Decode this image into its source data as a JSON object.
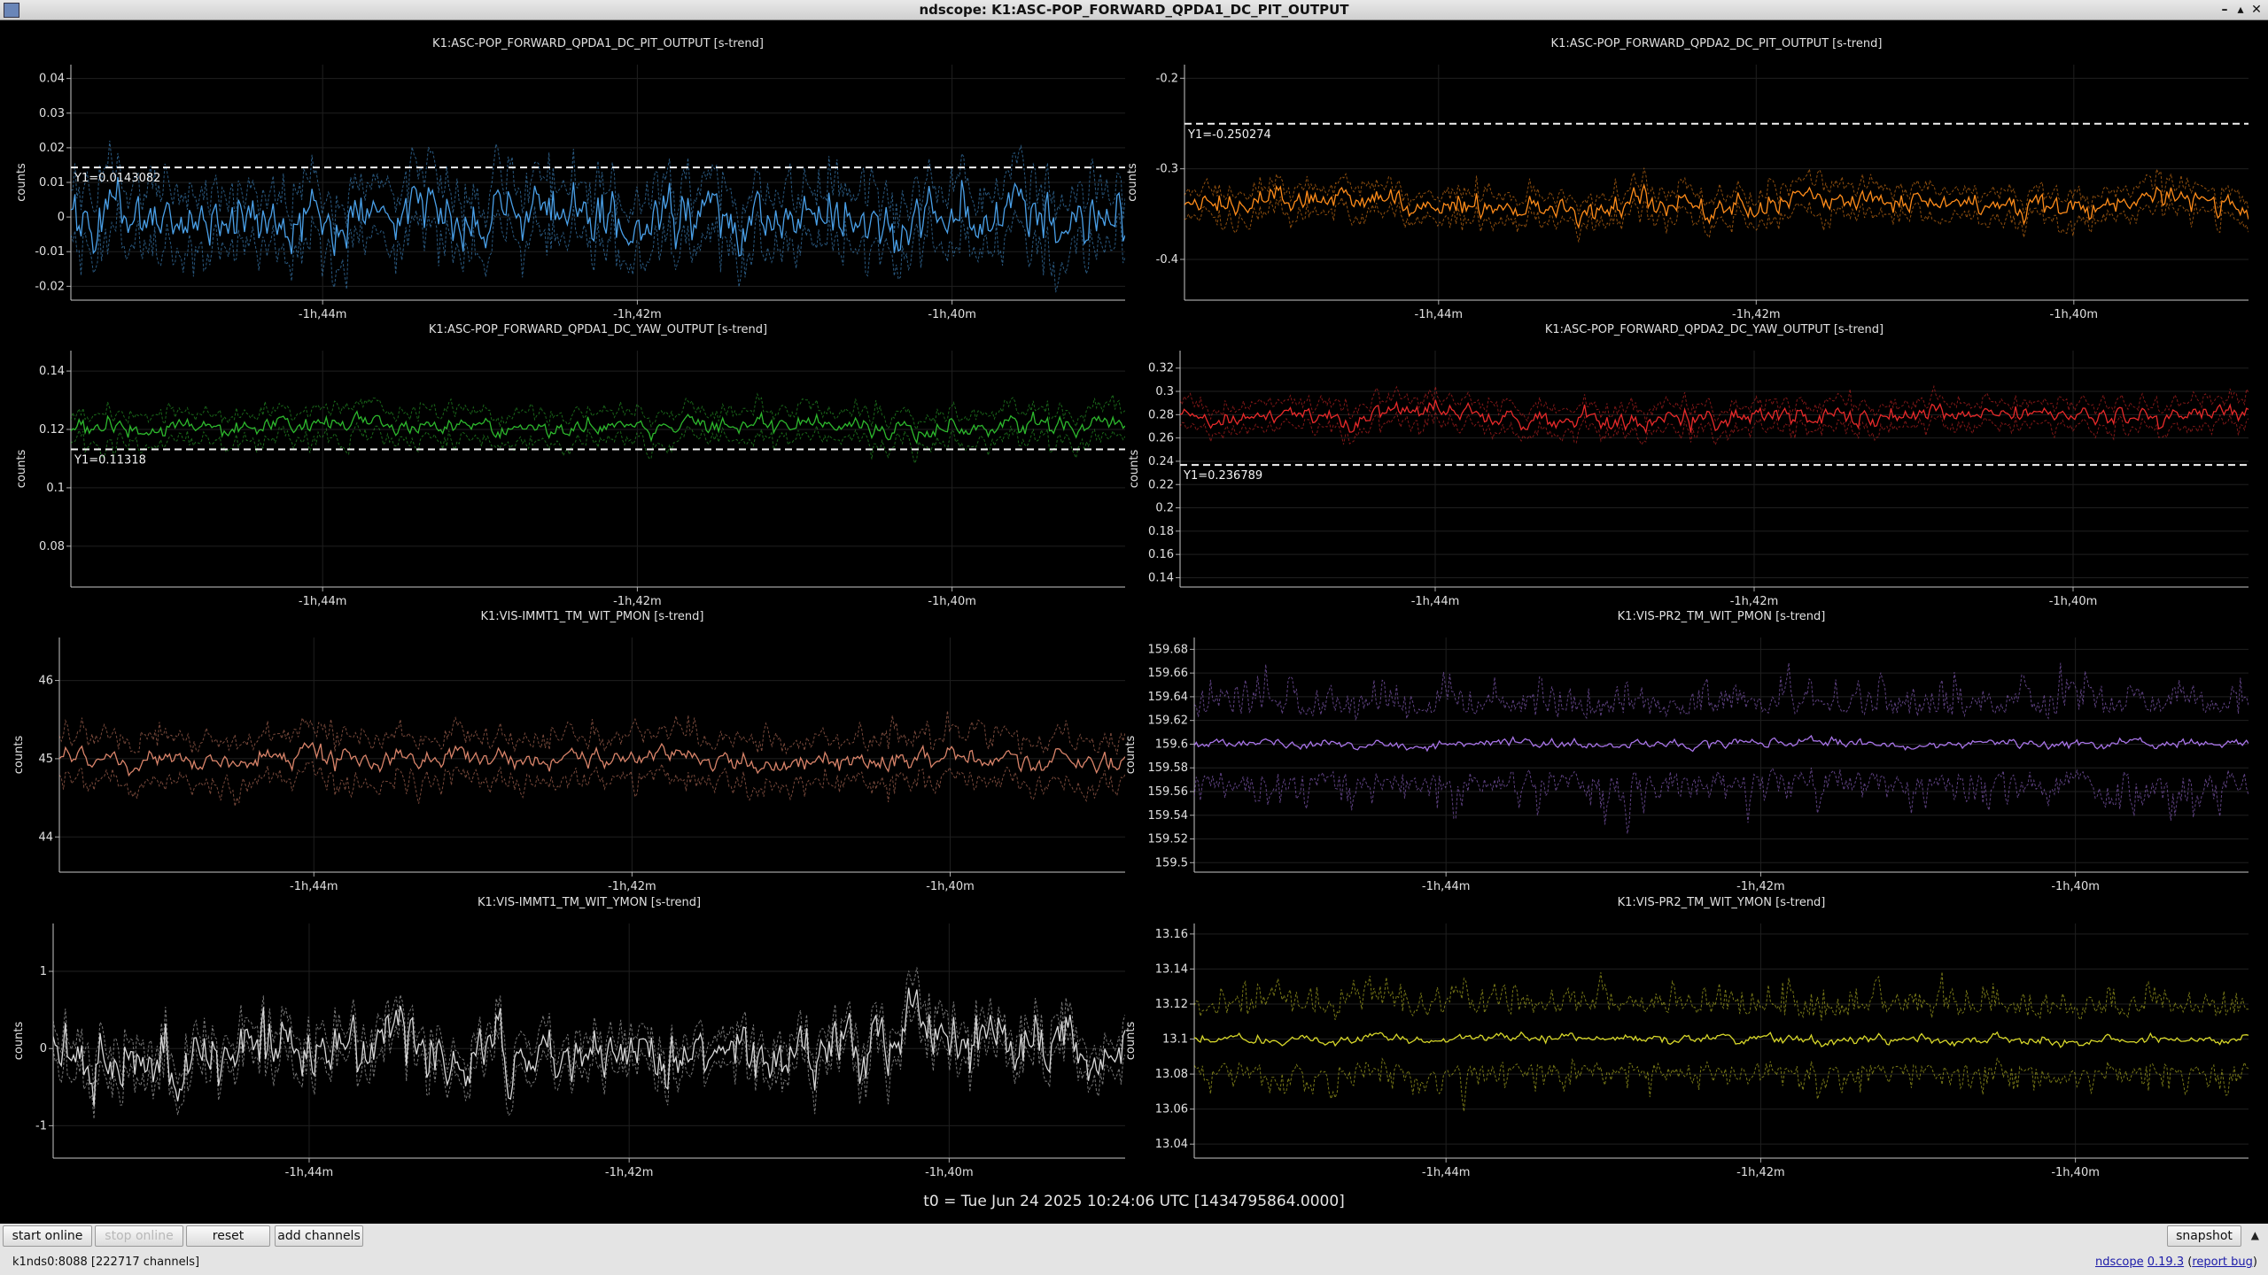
{
  "window": {
    "title": "ndscope: K1:ASC-POP_FORWARD_QPDA1_DC_PIT_OUTPUT",
    "controls": [
      "–",
      "▴",
      "✕"
    ]
  },
  "t0_label": "t0 = Tue Jun 24 2025 10:24:06 UTC [1434795864.0000]",
  "buttons": {
    "start_online": "start online",
    "stop_online": "stop online",
    "reset": "reset",
    "add_channels": "add channels",
    "snapshot": "snapshot"
  },
  "status": "k1nds0:8088  [222717 channels]",
  "footer": {
    "app": "ndscope",
    "version": "0.19.3",
    "report": "report bug"
  },
  "chart_data": [
    {
      "type": "line",
      "title": "K1:ASC-POP_FORWARD_QPDA1_DC_PIT_OUTPUT [s-trend]",
      "ylabel": "counts",
      "ylim": [
        -0.024,
        0.044
      ],
      "yticks": [
        -0.02,
        -0.01,
        0,
        0.01,
        0.02,
        0.03,
        0.04
      ],
      "ytick_labels": [
        "-0.02",
        "-0.01",
        "0",
        "0.01",
        "0.02",
        "0.03",
        "0.04"
      ],
      "xticks": [
        "-1h,44m",
        "-1h,42m",
        "-1h,40m"
      ],
      "x_range_minutes": [
        -105.6,
        -98.9
      ],
      "color": "#4aa0e8",
      "mean": 0.001,
      "spread": 0.009,
      "band": 0.01,
      "cursor": {
        "value": 0.0143082,
        "label": "Y1=0.0143082"
      }
    },
    {
      "type": "line",
      "title": "K1:ASC-POP_FORWARD_QPDA2_DC_PIT_OUTPUT [s-trend]",
      "ylabel": "counts",
      "ylim": [
        -0.445,
        -0.185
      ],
      "yticks": [
        -0.2,
        -0.3,
        -0.4
      ],
      "ytick_labels": [
        "-0.2",
        "-0.3",
        "-0.4"
      ],
      "xticks": [
        "-1h,44m",
        "-1h,42m",
        "-1h,40m"
      ],
      "x_range_minutes": [
        -105.6,
        -98.9
      ],
      "color": "#ff8c1a",
      "mean": -0.34,
      "spread": 0.014,
      "band": 0.018,
      "cursor": {
        "value": -0.250274,
        "label": "Y1=-0.250274"
      }
    },
    {
      "type": "line",
      "title": "K1:ASC-POP_FORWARD_QPDA1_DC_YAW_OUTPUT [s-trend]",
      "ylabel": "counts",
      "ylim": [
        0.066,
        0.147
      ],
      "yticks": [
        0.08,
        0.1,
        0.12,
        0.14
      ],
      "ytick_labels": [
        "0.08",
        "0.1",
        "0.12",
        "0.14"
      ],
      "xticks": [
        "-1h,44m",
        "-1h,42m",
        "-1h,40m"
      ],
      "x_range_minutes": [
        -105.6,
        -98.9
      ],
      "color": "#2db82d",
      "mean": 0.121,
      "spread": 0.0035,
      "band": 0.006,
      "cursor": {
        "value": 0.11318,
        "label": "Y1=0.11318"
      }
    },
    {
      "type": "line",
      "title": "K1:ASC-POP_FORWARD_QPDA2_DC_YAW_OUTPUT [s-trend]",
      "ylabel": "counts",
      "ylim": [
        0.132,
        0.335
      ],
      "yticks": [
        0.14,
        0.16,
        0.18,
        0.2,
        0.22,
        0.24,
        0.26,
        0.28,
        0.3,
        0.32
      ],
      "ytick_labels": [
        "0.14",
        "0.16",
        "0.18",
        "0.2",
        "0.22",
        "0.24",
        "0.26",
        "0.28",
        "0.3",
        "0.32"
      ],
      "xticks": [
        "-1h,44m",
        "-1h,42m",
        "-1h,40m"
      ],
      "x_range_minutes": [
        -105.6,
        -98.9
      ],
      "color": "#e82a2a",
      "mean": 0.278,
      "spread": 0.009,
      "band": 0.013,
      "cursor": {
        "value": 0.236789,
        "label": "Y1=0.236789"
      }
    },
    {
      "type": "line",
      "title": "K1:VIS-IMMT1_TM_WIT_PMON [s-trend]",
      "ylabel": "counts",
      "ylim": [
        43.55,
        46.55
      ],
      "yticks": [
        44,
        45,
        46
      ],
      "ytick_labels": [
        "44",
        "45",
        "46"
      ],
      "xticks": [
        "-1h,44m",
        "-1h,42m",
        "-1h,40m"
      ],
      "x_range_minutes": [
        -105.6,
        -98.9
      ],
      "color": "#d9846a",
      "mean": 44.98,
      "spread": 0.14,
      "band": 0.35
    },
    {
      "type": "line",
      "title": "K1:VIS-PR2_TM_WIT_PMON [s-trend]",
      "ylabel": "counts",
      "ylim": [
        159.492,
        159.69
      ],
      "yticks": [
        159.5,
        159.52,
        159.54,
        159.56,
        159.58,
        159.6,
        159.62,
        159.64,
        159.66,
        159.68
      ],
      "ytick_labels": [
        "159.5",
        "159.52",
        "159.54",
        "159.56",
        "159.58",
        "159.6",
        "159.62",
        "159.64",
        "159.66",
        "159.68"
      ],
      "xticks": [
        "-1h,44m",
        "-1h,42m",
        "-1h,40m"
      ],
      "x_range_minutes": [
        -105.6,
        -98.9
      ],
      "color": "#a874e8",
      "mean": 159.6,
      "spread": 0.004,
      "band": 0.045
    },
    {
      "type": "line",
      "title": "K1:VIS-IMMT1_TM_WIT_YMON [s-trend]",
      "ylabel": "counts",
      "ylim": [
        -1.42,
        1.62
      ],
      "yticks": [
        -1,
        0,
        1
      ],
      "ytick_labels": [
        "-1",
        "0",
        "1"
      ],
      "xticks": [
        "-1h,44m",
        "-1h,42m",
        "-1h,40m"
      ],
      "x_range_minutes": [
        -105.6,
        -98.9
      ],
      "color": "#d8d8d8",
      "mean": 0.0,
      "spread": 0.42,
      "band": 0.25
    },
    {
      "type": "line",
      "title": "K1:VIS-PR2_TM_WIT_YMON [s-trend]",
      "ylabel": "counts",
      "ylim": [
        13.032,
        13.166
      ],
      "yticks": [
        13.04,
        13.06,
        13.08,
        13.1,
        13.12,
        13.14,
        13.16
      ],
      "ytick_labels": [
        "13.04",
        "13.06",
        "13.08",
        "13.1",
        "13.12",
        "13.14",
        "13.16"
      ],
      "xticks": [
        "-1h,44m",
        "-1h,42m",
        "-1h,40m"
      ],
      "x_range_minutes": [
        -105.6,
        -98.9
      ],
      "color": "#d8d82a",
      "mean": 13.1,
      "spread": 0.003,
      "band": 0.026
    }
  ]
}
